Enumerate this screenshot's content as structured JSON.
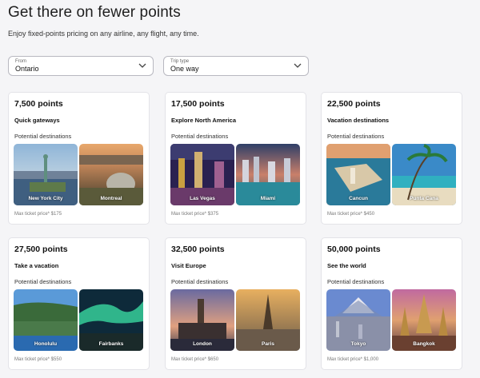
{
  "header": {
    "title": "Get there on fewer points",
    "subtitle": "Enjoy fixed-points pricing on any airline, any flight, any time."
  },
  "filters": {
    "from": {
      "label": "From",
      "value": "Ontario"
    },
    "trip_type": {
      "label": "Trip type",
      "value": "One way"
    }
  },
  "common": {
    "potential_label": "Potential destinations"
  },
  "cards": [
    {
      "points": "7,500 points",
      "name": "Quick gateways",
      "max": "Max ticket price* $175",
      "destinations": [
        "New York City",
        "Montreal"
      ]
    },
    {
      "points": "17,500 points",
      "name": "Explore North America",
      "max": "Max ticket price* $375",
      "destinations": [
        "Las Vegas",
        "Miami"
      ]
    },
    {
      "points": "22,500 points",
      "name": "Vacation destinations",
      "max": "Max ticket price* $450",
      "destinations": [
        "Cancun",
        "Punta Cana"
      ]
    },
    {
      "points": "27,500 points",
      "name": "Take a vacation",
      "max": "Max ticket price* $550",
      "destinations": [
        "Honolulu",
        "Fairbanks"
      ]
    },
    {
      "points": "32,500 points",
      "name": "Visit Europe",
      "max": "Max ticket price* $650",
      "destinations": [
        "London",
        "Paris"
      ]
    },
    {
      "points": "50,000 points",
      "name": "See the world",
      "max": "Max ticket price* $1,000",
      "destinations": [
        "Tokyo",
        "Bangkok"
      ]
    }
  ],
  "colors": {
    "card_border": "#e3e3e8",
    "page_bg": "#f5f5f7"
  }
}
